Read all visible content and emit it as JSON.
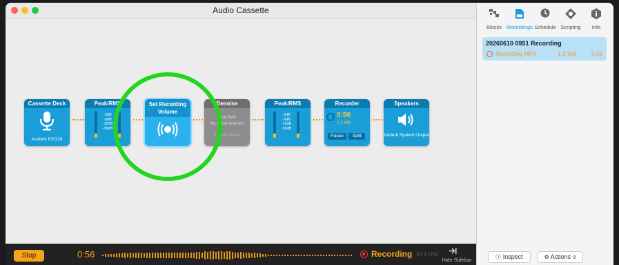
{
  "window": {
    "title": "Audio Cassette"
  },
  "traffic_lights": {
    "close_color": "#fe5f57",
    "minimize_color": "#febc2e",
    "zoom_color": "#28c840"
  },
  "blocks": {
    "cassette_deck": {
      "title": "Cassette Deck",
      "caption": "Audient EVO16",
      "icon": "microphone-icon"
    },
    "peak_rms_1": {
      "title": "Peak/RMS",
      "scale": [
        "-3dB",
        "-9dB",
        "-18dB",
        "-36dB"
      ]
    },
    "set_volume": {
      "title": "Set Recording Volume",
      "icon": "broadcast-icon"
    },
    "denoise": {
      "title": "Denoise",
      "status": "Inactive",
      "note": "No noise learned",
      "button": "Learn Noise"
    },
    "peak_rms_2": {
      "title": "Peak/RMS",
      "scale": [
        "-3dB",
        "-9dB",
        "-18dB",
        "-36dB"
      ]
    },
    "recorder": {
      "title": "Recorder",
      "time": "0:56",
      "size": "1.2 MB",
      "pause": "Pause",
      "split": "Split"
    },
    "speakers": {
      "title": "Speakers",
      "caption": "Default System Output",
      "icon": "speaker-icon"
    }
  },
  "bottom": {
    "stop_label": "Stop",
    "time": "0:56",
    "recording_label": "Recording",
    "sample_rate": "44.1 kHz",
    "hide_sidebar_label": "Hide Sidebar"
  },
  "sidebar": {
    "tabs": [
      {
        "label": "Blocks",
        "icon": "blocks-icon",
        "active": false
      },
      {
        "label": "Recordings",
        "icon": "recordings-icon",
        "active": true
      },
      {
        "label": "Schedule",
        "icon": "clock-icon",
        "active": false
      },
      {
        "label": "Scripting",
        "icon": "scripting-icon",
        "active": false
      },
      {
        "label": "Info",
        "icon": "info-icon",
        "active": false
      }
    ],
    "recording": {
      "name": "20260610 0951 Recording",
      "format": "Recording MP3",
      "size": "1.2 MB",
      "duration": "0:56"
    },
    "inspect_label": "Inspect",
    "actions_label": "Actions"
  },
  "colors": {
    "accent": "#1a9ed8",
    "orange": "#f6a21b",
    "highlight_ring": "#22d61f",
    "record_red": "#ff3b30"
  }
}
